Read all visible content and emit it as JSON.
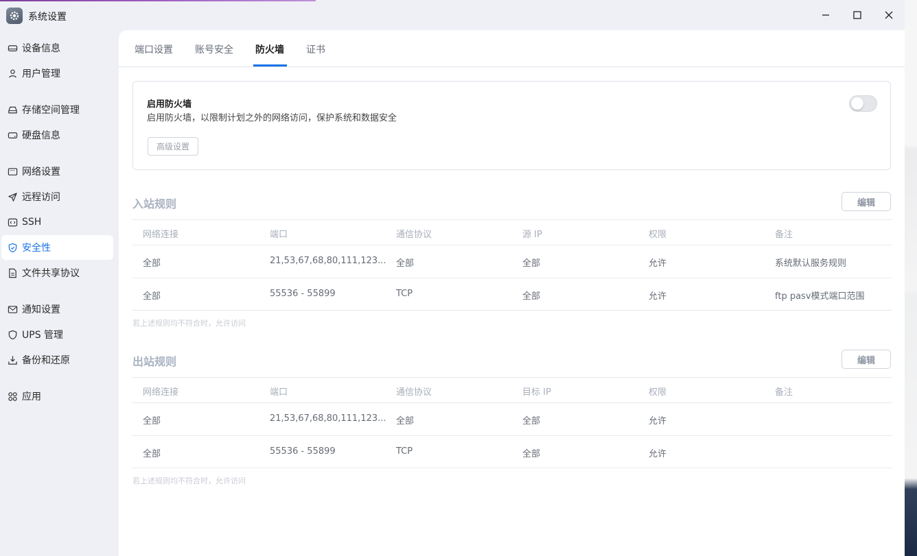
{
  "app": {
    "title": "系统设置"
  },
  "sidebar": {
    "items": [
      {
        "label": "设备信息",
        "icon": "device-icon"
      },
      {
        "label": "用户管理",
        "icon": "user-icon"
      },
      {
        "label": "存储空间管理",
        "icon": "storage-icon"
      },
      {
        "label": "硬盘信息",
        "icon": "disk-icon"
      },
      {
        "label": "网络设置",
        "icon": "network-icon"
      },
      {
        "label": "远程访问",
        "icon": "send-icon"
      },
      {
        "label": "SSH",
        "icon": "ssh-icon"
      },
      {
        "label": "安全性",
        "icon": "shield-check-icon",
        "active": true
      },
      {
        "label": "文件共享协议",
        "icon": "file-icon"
      },
      {
        "label": "通知设置",
        "icon": "mail-icon"
      },
      {
        "label": "UPS 管理",
        "icon": "shield-icon"
      },
      {
        "label": "备份和还原",
        "icon": "backup-icon"
      },
      {
        "label": "应用",
        "icon": "apps-icon"
      }
    ]
  },
  "tabs": [
    {
      "label": "端口设置"
    },
    {
      "label": "账号安全"
    },
    {
      "label": "防火墙",
      "active": true
    },
    {
      "label": "证书"
    }
  ],
  "firewall": {
    "title": "启用防火墙",
    "description": "启用防火墙，以限制计划之外的网络访问，保护系统和数据安全",
    "enabled": false,
    "advanced_label": "高级设置"
  },
  "inbound": {
    "title": "入站规则",
    "edit_label": "编辑",
    "headers": [
      "网络连接",
      "端口",
      "通信协议",
      "源 IP",
      "权限",
      "备注"
    ],
    "rows": [
      [
        "全部",
        "21,53,67,68,80,111,123...",
        "全部",
        "全部",
        "允许",
        "系统默认服务规则"
      ],
      [
        "全部",
        "55536 - 55899",
        "TCP",
        "全部",
        "允许",
        "ftp pasv模式端口范围"
      ]
    ],
    "hint": "若上述规则均不符合时，允许访问"
  },
  "outbound": {
    "title": "出站规则",
    "edit_label": "编辑",
    "headers": [
      "网络连接",
      "端口",
      "通信协议",
      "目标 IP",
      "权限",
      "备注"
    ],
    "rows": [
      [
        "全部",
        "21,53,67,68,80,111,123...",
        "全部",
        "全部",
        "允许",
        ""
      ],
      [
        "全部",
        "55536 - 55899",
        "TCP",
        "全部",
        "允许",
        ""
      ]
    ],
    "hint": "若上述规则均不符合时，允许访问"
  },
  "colors": {
    "accent": "#1a73e8",
    "sidebar_bg": "#eef0f5"
  }
}
